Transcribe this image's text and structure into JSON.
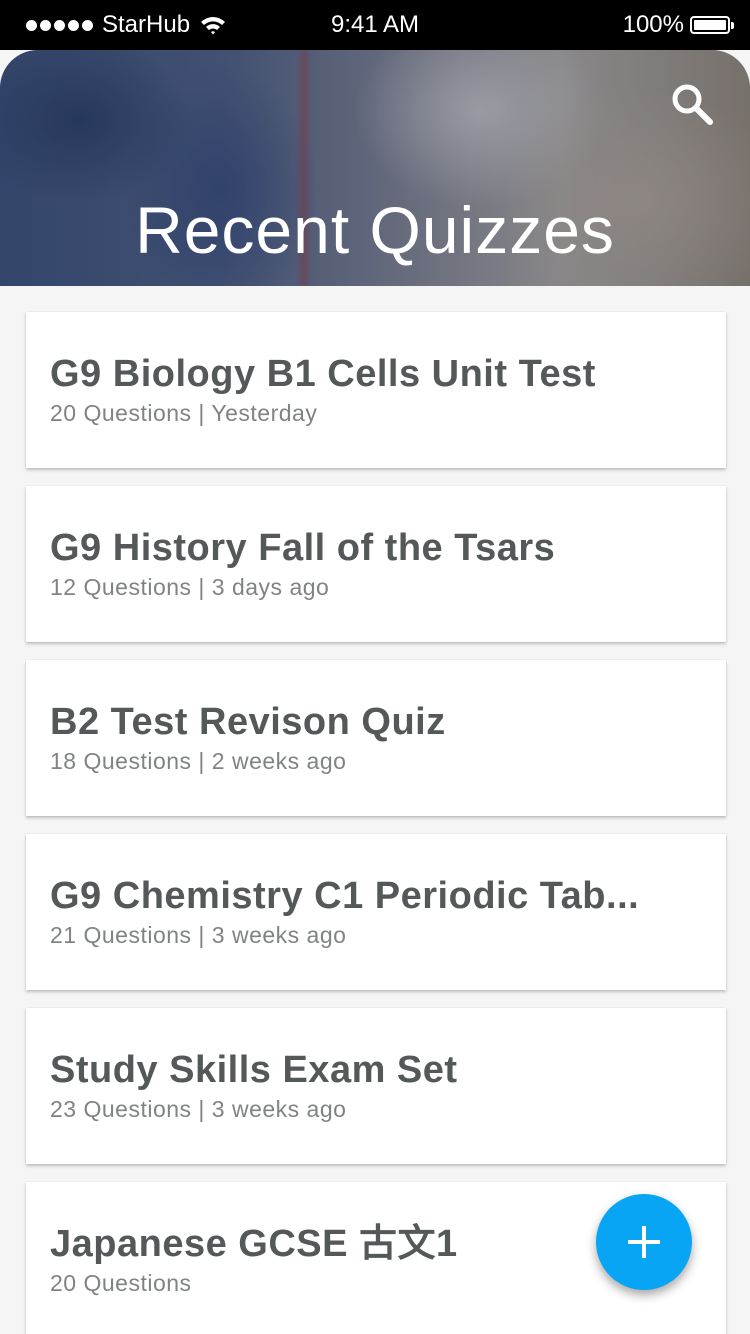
{
  "status_bar": {
    "carrier": "StarHub",
    "time": "9:41 AM",
    "battery": "100%"
  },
  "header": {
    "title": "Recent Quizzes",
    "search_icon": "search-icon"
  },
  "quizzes": [
    {
      "title": "G9 Biology B1 Cells Unit Test",
      "meta": "20 Questions | Yesterday"
    },
    {
      "title": "G9 History Fall of the Tsars",
      "meta": "12 Questions | 3 days ago"
    },
    {
      "title": "B2 Test Revison Quiz",
      "meta": "18 Questions | 2 weeks ago"
    },
    {
      "title": "G9 Chemistry C1 Periodic Tab...",
      "meta": "21 Questions | 3 weeks ago"
    },
    {
      "title": "Study Skills Exam Set",
      "meta": "23 Questions | 3 weeks ago"
    },
    {
      "title": "Japanese GCSE 古文1",
      "meta": "20 Questions"
    }
  ],
  "fab": {
    "icon": "plus-icon",
    "color": "#08a5f5"
  }
}
